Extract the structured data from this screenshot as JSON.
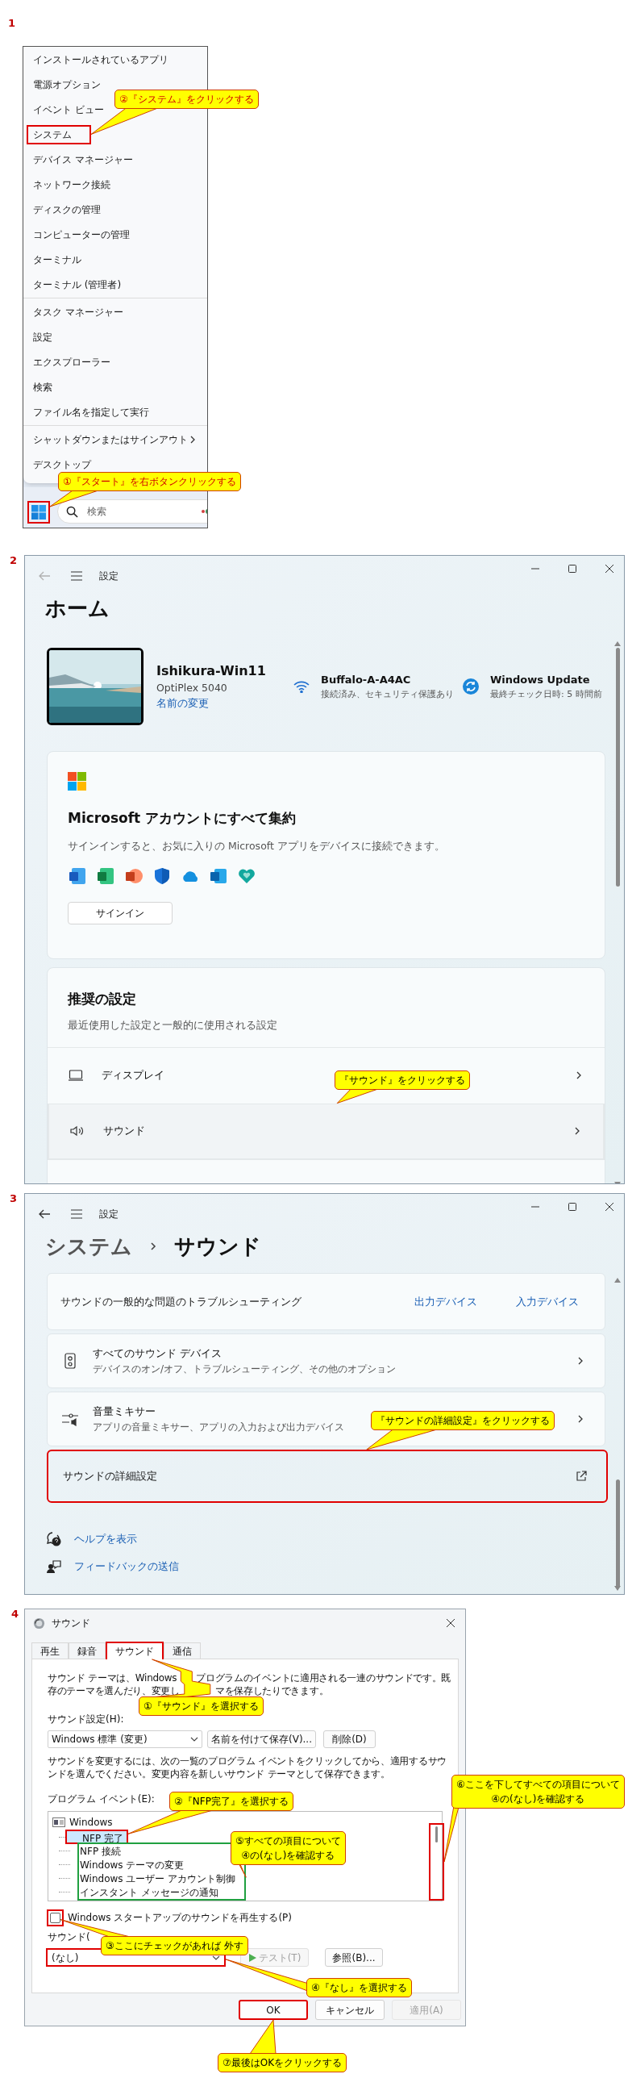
{
  "start_menu_step": {
    "step_number": "1",
    "menu_groups": [
      {
        "items": [
          {
            "label": "インストールされているアプリ",
            "highlighted": false,
            "submenu": false
          },
          {
            "label": "電源オプション",
            "highlighted": false,
            "submenu": false
          },
          {
            "label": "イベント ビュー",
            "highlighted": false,
            "submenu": false
          },
          {
            "label": "システム",
            "highlighted": true,
            "submenu": false
          },
          {
            "label": "デバイス マネージャー",
            "highlighted": false,
            "submenu": false
          },
          {
            "label": "ネットワーク接続",
            "highlighted": false,
            "submenu": false
          },
          {
            "label": "ディスクの管理",
            "highlighted": false,
            "submenu": false
          },
          {
            "label": "コンピューターの管理",
            "highlighted": false,
            "submenu": false
          },
          {
            "label": "ターミナル",
            "highlighted": false,
            "submenu": false
          },
          {
            "label": "ターミナル (管理者)",
            "highlighted": false,
            "submenu": false
          }
        ]
      },
      {
        "items": [
          {
            "label": "タスク マネージャー",
            "highlighted": false,
            "submenu": false
          },
          {
            "label": "設定",
            "highlighted": false,
            "submenu": false
          },
          {
            "label": "エクスプローラー",
            "highlighted": false,
            "submenu": false
          },
          {
            "label": "検索",
            "highlighted": false,
            "submenu": false
          },
          {
            "label": "ファイル名を指定して実行",
            "highlighted": false,
            "submenu": false
          }
        ]
      },
      {
        "items": [
          {
            "label": "シャットダウンまたはサインアウト",
            "highlighted": false,
            "submenu": true
          },
          {
            "label": "デスクトップ",
            "highlighted": false,
            "submenu": false
          }
        ]
      }
    ],
    "start_highlighted": true,
    "search_placeholder": "検索",
    "callouts": [
      {
        "lines": [
          "②『システム』をクリックする"
        ]
      },
      {
        "lines": [
          "①『スタート』を右ボタンクリックする"
        ]
      }
    ]
  },
  "settings_home_step": {
    "step_number": "2",
    "app_title": "設定",
    "back_enabled": false,
    "heading": "ホーム",
    "device": {
      "name": "Ishikura-Win11",
      "model": "OptiPlex 5040",
      "rename_link": "名前の変更"
    },
    "status": [
      {
        "kind": "wifi",
        "title": "Buffalo-A-A4AC",
        "detail": "接続済み、セキュリティ保護あり"
      },
      {
        "kind": "update",
        "title": "Windows Update",
        "detail": "最終チェック日時: 5 時間前"
      }
    ],
    "account_card": {
      "heading": "Microsoft アカウントにすべて集約",
      "description": "サインインすると、お気に入りの Microsoft アプリをデバイスに接続できます。",
      "button": "サインイン"
    },
    "recommended_card": {
      "heading": "推奨の設定",
      "description": "最近使用した設定と一般的に使用される設定",
      "rows": [
        {
          "kind": "display",
          "label": "ディスプレイ",
          "highlighted": false
        },
        {
          "kind": "sound",
          "label": "サウンド",
          "highlighted": true
        }
      ]
    },
    "callouts": [
      {
        "lines": [
          "『サウンド』をクリックする"
        ]
      }
    ]
  },
  "sound_settings_step": {
    "step_number": "3",
    "app_title": "設定",
    "back_enabled": true,
    "breadcrumb": [
      {
        "label": "システム",
        "current": false
      },
      {
        "label": "サウンド",
        "current": true
      }
    ],
    "troubleshoot": {
      "label": "サウンドの一般的な問題のトラブルシューティング",
      "links": [
        "出力デバイス",
        "入力デバイス"
      ]
    },
    "rows": [
      {
        "kind": "devices",
        "title": "すべてのサウンド デバイス",
        "subtitle": "デバイスのオン/オフ、トラブルシューティング、その他のオプション",
        "highlighted": false
      },
      {
        "kind": "mixer",
        "title": "音量ミキサー",
        "subtitle": "アプリの音量ミキサー、アプリの入力および出力デバイス",
        "highlighted": false
      },
      {
        "kind": "advanced",
        "title": "サウンドの詳細設定",
        "highlighted": true
      }
    ],
    "help_links": [
      {
        "kind": "help",
        "label": "ヘルプを表示"
      },
      {
        "kind": "feedback",
        "label": "フィードバックの送信"
      }
    ],
    "callouts": [
      {
        "lines": [
          "『サウンドの詳細設定』をクリックする"
        ]
      }
    ]
  },
  "sound_dialog_step": {
    "step_number": "4",
    "title": "サウンド",
    "tabs": [
      {
        "label": "再生",
        "selected": false,
        "highlighted": false
      },
      {
        "label": "録音",
        "selected": false,
        "highlighted": false
      },
      {
        "label": "サウンド",
        "selected": true,
        "highlighted": true
      },
      {
        "label": "通信",
        "selected": false,
        "highlighted": false
      }
    ],
    "description_lines": [
      [
        "サウンド テーマは、Windows",
        "プログラムのイベントに適用される一連のサウンドです。既"
      ],
      [
        "存のテーマを選んだり、変更し",
        "マを保存したりできます。"
      ]
    ],
    "scheme_label": "サウンド設定(H):",
    "scheme_value": "Windows 標準 (変更)",
    "save_button": "名前を付けて保存(V)...",
    "delete_button": "削除(D)",
    "instructions": "サウンドを変更するには、次の一覧のプログラム イベントをクリックしてから、適用するサウンドを選んでください。変更内容を新しいサウンド テーマとして保存できます。",
    "events_label": "プログラム イベント(E):",
    "events": [
      {
        "label": "Windows",
        "selected": false,
        "highlighted": false,
        "framed": false,
        "children": [
          {
            "label": "NFP 完了",
            "selected": true,
            "highlighted": true,
            "framed": false
          },
          {
            "label": "NFP 接続",
            "selected": false,
            "highlighted": false,
            "framed": true
          },
          {
            "label": "Windows テーマの変更",
            "selected": false,
            "highlighted": false,
            "framed": true
          },
          {
            "label": "Windows ユーザー アカウント制御",
            "selected": false,
            "highlighted": false,
            "framed": true
          },
          {
            "label": "インスタント メッセージの通知",
            "selected": false,
            "highlighted": false,
            "framed": true
          }
        ]
      }
    ],
    "list_scrollbar_highlighted": true,
    "startup_checkbox": {
      "label": "Windows スタートアップのサウンドを再生する(P)",
      "checked": false,
      "highlighted": true
    },
    "sound_label": "サウンド(",
    "sound_value": "(なし)",
    "sound_highlighted": true,
    "test_button": {
      "label": "テスト(T)",
      "disabled": true
    },
    "browse_button": {
      "label": "参照(B)...",
      "disabled": false
    },
    "footer_buttons": [
      {
        "label": "OK",
        "disabled": false,
        "highlighted": true
      },
      {
        "label": "キャンセル",
        "disabled": false,
        "highlighted": false
      },
      {
        "label": "適用(A)",
        "disabled": true,
        "highlighted": false
      }
    ],
    "callouts": [
      {
        "lines": [
          "①『サウンド』を選択する"
        ]
      },
      {
        "lines": [
          "②『NFP完了』を選択する"
        ]
      },
      {
        "lines": [
          "⑤すべての項目について",
          "④の(なし)を確認する"
        ]
      },
      {
        "lines": [
          "⑥ここを下してすべての項目について",
          "④の(なし)を確認する"
        ]
      },
      {
        "lines": [
          "③ここにチェックがあれば 外す"
        ]
      },
      {
        "lines": [
          "④『なし』を選択する"
        ]
      },
      {
        "lines": [
          "⑦最後はOKをクリックする"
        ]
      }
    ]
  }
}
